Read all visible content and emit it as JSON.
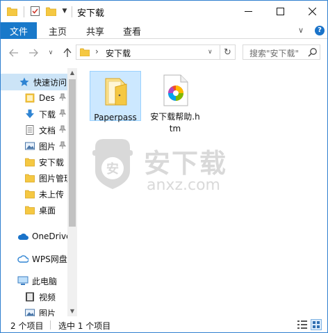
{
  "window": {
    "title": "安下载"
  },
  "ribbon": {
    "file_tab": "文件",
    "tabs": [
      "主页",
      "共享",
      "查看"
    ],
    "help": "?"
  },
  "address_bar": {
    "separator": "›",
    "path": "安下载",
    "search_placeholder": "搜索\"安下载\""
  },
  "sidebar": {
    "items": [
      {
        "label": "快速访问",
        "icon": "star-icon",
        "pinned": false,
        "selected": true
      },
      {
        "label": "Des",
        "icon": "desktop-folder-icon",
        "pinned": true
      },
      {
        "label": "下载",
        "icon": "download-arrow-icon",
        "pinned": true
      },
      {
        "label": "文档",
        "icon": "document-icon",
        "pinned": true
      },
      {
        "label": "图片",
        "icon": "pictures-icon",
        "pinned": true
      },
      {
        "label": "安下载",
        "icon": "folder-icon",
        "pinned": false
      },
      {
        "label": "图片管理",
        "icon": "folder-icon",
        "pinned": false
      },
      {
        "label": "未上传",
        "icon": "folder-icon",
        "pinned": false
      },
      {
        "label": "桌面",
        "icon": "folder-icon",
        "pinned": false
      },
      {
        "label": "OneDrive",
        "icon": "onedrive-cloud-icon",
        "pinned": false
      },
      {
        "label": "WPS网盘",
        "icon": "wps-cloud-icon",
        "pinned": false
      },
      {
        "label": "此电脑",
        "icon": "computer-icon",
        "pinned": false
      },
      {
        "label": "视频",
        "icon": "video-icon",
        "pinned": false
      },
      {
        "label": "图片",
        "icon": "pictures-icon",
        "pinned": false
      }
    ]
  },
  "files": [
    {
      "name": "Paperpass",
      "type": "folder",
      "selected": true
    },
    {
      "name": "安下载帮助.htm",
      "type": "htm",
      "selected": false
    }
  ],
  "watermark": {
    "text": "安下载",
    "sub": "anxz.com",
    "badge": "安"
  },
  "status_bar": {
    "item_count": "2 个项目",
    "selected_count": "选中 1 个项目"
  },
  "colors": {
    "accent": "#1979ca",
    "selection": "#cce8ff",
    "folder": "#f5c842"
  }
}
